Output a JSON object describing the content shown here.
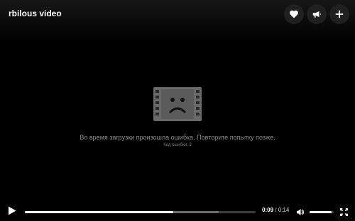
{
  "header": {
    "title": "rbilous video",
    "actions": [
      {
        "icon": "heart-icon"
      },
      {
        "icon": "megaphone-icon"
      },
      {
        "icon": "plus-icon"
      }
    ]
  },
  "error": {
    "icon": "sad-film-icon",
    "message": "Во время загрузки произошла ошибка. Повторите попытку позже.",
    "code": "Код ошибки: 3"
  },
  "controls": {
    "play_icon": "play-icon",
    "current_time": "0:09",
    "separator": "/",
    "duration": "0:14",
    "progress_fraction": 0.643,
    "buffered_fraction": 0.84,
    "volume_icon": "volume-icon",
    "volume_level": 0.9,
    "fullscreen_icon": "fullscreen-icon"
  }
}
